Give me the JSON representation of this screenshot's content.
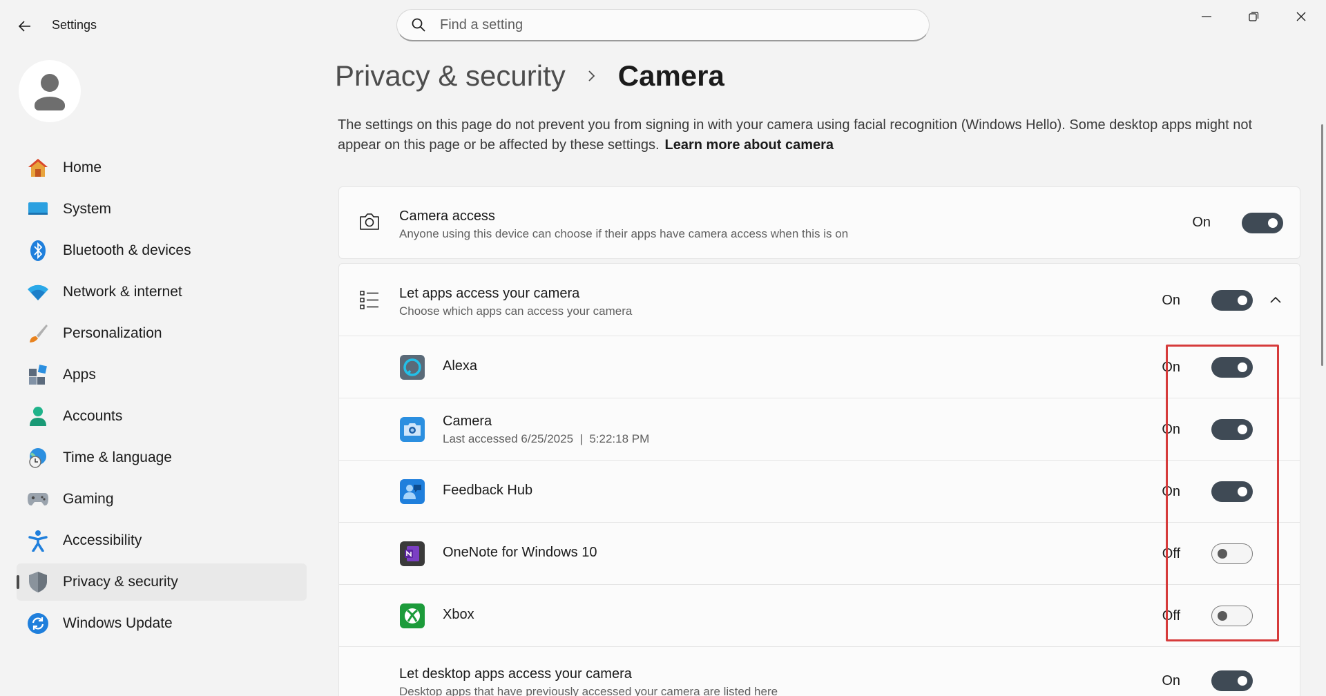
{
  "window": {
    "title": "Settings"
  },
  "search": {
    "placeholder": "Find a setting"
  },
  "sidebar": {
    "items": [
      {
        "label": "Home"
      },
      {
        "label": "System"
      },
      {
        "label": "Bluetooth & devices"
      },
      {
        "label": "Network & internet"
      },
      {
        "label": "Personalization"
      },
      {
        "label": "Apps"
      },
      {
        "label": "Accounts"
      },
      {
        "label": "Time & language"
      },
      {
        "label": "Gaming"
      },
      {
        "label": "Accessibility"
      },
      {
        "label": "Privacy & security"
      },
      {
        "label": "Windows Update"
      }
    ],
    "active_index": 10
  },
  "breadcrumb": {
    "parent": "Privacy & security",
    "current": "Camera"
  },
  "description": {
    "text": "The settings on this page do not prevent you from signing in with your camera using facial recognition (Windows Hello). Some desktop apps might not appear on this page or be affected by these settings.",
    "link": "Learn more about camera"
  },
  "camera_access": {
    "title": "Camera access",
    "subtitle": "Anyone using this device can choose if their apps have camera access when this is on",
    "state": "On"
  },
  "apps_access": {
    "title": "Let apps access your camera",
    "subtitle": "Choose which apps can access your camera",
    "state": "On",
    "apps": [
      {
        "name": "Alexa",
        "detail": "",
        "state": "On"
      },
      {
        "name": "Camera",
        "detail": "Last accessed 6/25/2025  |  5:22:18 PM",
        "state": "On"
      },
      {
        "name": "Feedback Hub",
        "detail": "",
        "state": "On"
      },
      {
        "name": "OneNote for Windows 10",
        "detail": "",
        "state": "Off"
      },
      {
        "name": "Xbox",
        "detail": "",
        "state": "Off"
      }
    ]
  },
  "desktop_access": {
    "title": "Let desktop apps access your camera",
    "subtitle": "Desktop apps that have previously accessed your camera are listed here",
    "state": "On"
  },
  "colors": {
    "toggle_on": "#3f4a55",
    "highlight": "#d63b3b",
    "accent": "#0067c0"
  }
}
